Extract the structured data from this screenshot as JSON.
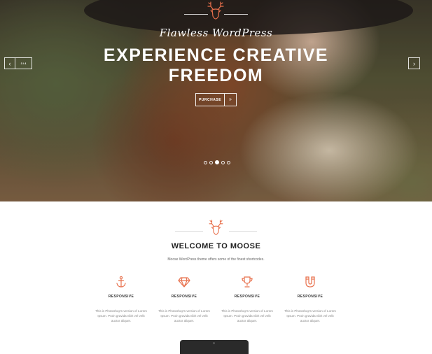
{
  "hero": {
    "subtitle": "Flawless WordPress",
    "headline_line1": "EXPERIENCE CREATIVE",
    "headline_line2": "FREEDOM",
    "purchase_label": "PURCHASE",
    "purchase_arrow": "»",
    "slide_counter": "3 / 4",
    "prev_glyph": "‹",
    "next_glyph": "›",
    "slides_total": 5,
    "active_slide": 3
  },
  "welcome": {
    "title": "WELCOME TO MOOSE",
    "subtitle": "Moose WordPress theme offers some of the finest shortcodes."
  },
  "features": [
    {
      "icon": "anchor-icon",
      "title": "RESPONSIVE",
      "desc_line1": "This is Photoshop's version  of Lorem",
      "desc_line2": "Ipsum. Proin gravida nibh vel velit",
      "desc_line3": "auctor aliquet."
    },
    {
      "icon": "diamond-icon",
      "title": "RESPONSIVE",
      "desc_line1": "This is Photoshop's version  of Lorem",
      "desc_line2": "Ipsum. Proin gravida nibh vel velit",
      "desc_line3": "auctor aliquet."
    },
    {
      "icon": "trophy-icon",
      "title": "RESPONSIVE",
      "desc_line1": "This is Photoshop's version  of Lorem",
      "desc_line2": "Ipsum. Proin gravida nibh vel velit",
      "desc_line3": "auctor aliquet."
    },
    {
      "icon": "magnet-icon",
      "title": "RESPONSIVE",
      "desc_line1": "This is Photoshop's version  of Lorem",
      "desc_line2": "Ipsum. Proin gravida nibh vel velit",
      "desc_line3": "auctor aliquet."
    }
  ],
  "colors": {
    "accent": "#e8704c",
    "text_dark": "#222222",
    "text_muted": "#888888"
  }
}
